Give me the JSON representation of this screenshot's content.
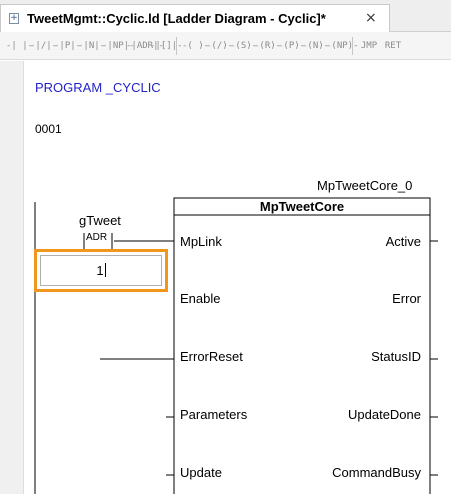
{
  "tab": {
    "title": "TweetMgmt::Cyclic.ld [Ladder Diagram - Cyclic]*",
    "close": "×"
  },
  "toolbar": {
    "group1": [
      "-| |-",
      "-|/|-",
      "-|P|-",
      "-|N|-",
      "-|NP|-",
      "-|ADR|-",
      "-|[]|-"
    ],
    "group2": [
      "-( )-",
      "-(/)-",
      "-(S)-",
      "-(R)-",
      "-(P)-",
      "-(N)-",
      "-(NP)-"
    ],
    "group3": [
      "JMP",
      "RET"
    ]
  },
  "editor": {
    "program": "PROGRAM _CYCLIC",
    "rung_number": "0001",
    "instance_name": "MpTweetCore_0",
    "fb_type": "MpTweetCore",
    "variable": "gTweet",
    "adr_label": "ADR",
    "edit_value": "1",
    "inputs": [
      "MpLink",
      "Enable",
      "ErrorReset",
      "Parameters",
      "Update"
    ],
    "outputs": [
      "Active",
      "Error",
      "StatusID",
      "UpdateDone",
      "CommandBusy"
    ]
  },
  "colors": {
    "keyword": "#2323c8",
    "highlight": "#f0961c"
  }
}
